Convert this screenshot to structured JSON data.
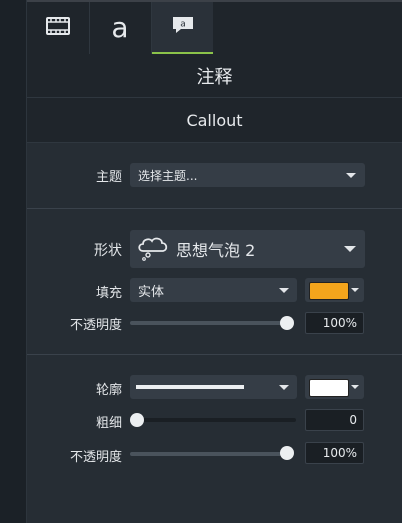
{
  "tabs": [
    {
      "id": "media",
      "icon": "film-icon",
      "label": ""
    },
    {
      "id": "text",
      "icon": "letter-a",
      "label": "a"
    },
    {
      "id": "annotations",
      "icon": "callout-icon",
      "label": ""
    }
  ],
  "header": {
    "title": "注释",
    "subtitle": "Callout"
  },
  "theme": {
    "label": "主题",
    "value": "选择主题..."
  },
  "shape": {
    "label": "形状",
    "value": "思想气泡 2",
    "icon": "thought-bubble-icon"
  },
  "fill": {
    "label": "填充",
    "value": "实体",
    "color": "#f4a51c"
  },
  "fill_opacity": {
    "label": "不透明度",
    "value": "100%",
    "level": 1.0
  },
  "outline": {
    "label": "轮廓",
    "color": "#ffffff"
  },
  "thickness": {
    "label": "粗细",
    "value": "0",
    "level": 0.0
  },
  "outline_opacity": {
    "label": "不透明度",
    "value": "100%",
    "level": 1.0
  },
  "colors": {
    "accent": "#8bc34a",
    "panel": "#262d34",
    "header": "#1f252b"
  }
}
